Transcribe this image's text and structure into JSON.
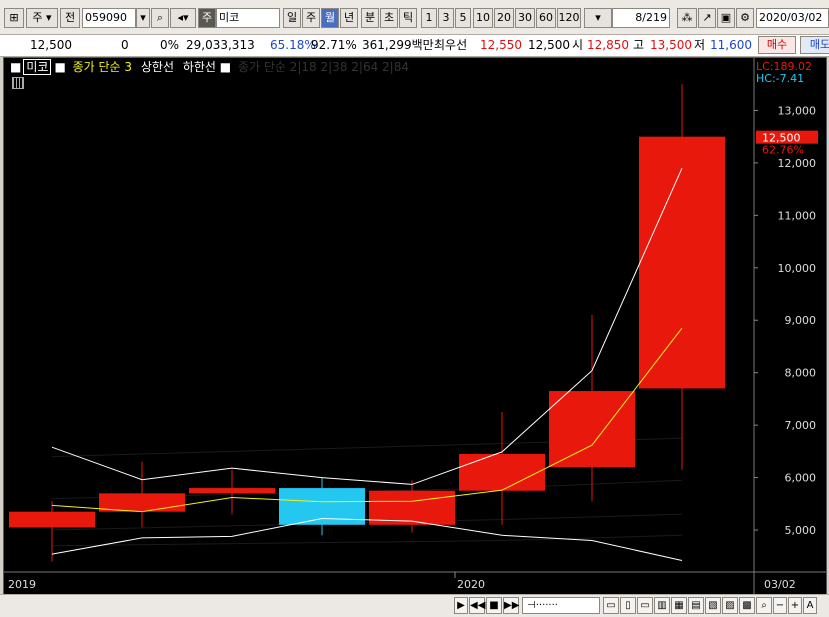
{
  "toolbar": {
    "period_label": "주",
    "prev_label": "전",
    "code": "059090",
    "market_tag": "주",
    "stock_name": "미코",
    "intervals": [
      "일",
      "주",
      "월",
      "년",
      "분",
      "초",
      "틱"
    ],
    "selected_interval": "월",
    "numbers": [
      "1",
      "3",
      "5",
      "10",
      "20",
      "30",
      "60",
      "120"
    ],
    "counter": "8/219",
    "date": "2020/03/02"
  },
  "quote": {
    "price": "12,500",
    "change": "0",
    "change_rate": "0%",
    "volume": "29,033,313",
    "pct1": "65.18%",
    "pct2": "92.71%",
    "amount": "361,299백만",
    "preferred_label": "최우선",
    "preferred_value": "12,550",
    "ask_value": "12,500",
    "open_label": "시",
    "open_value": "12,850",
    "high_label": "고",
    "high_value": "13,500",
    "low_label": "저",
    "low_value": "11,600",
    "buy_label": "매수",
    "sell_label": "매도"
  },
  "legend": {
    "tag": "미코",
    "ma_label": "종가 단순 3",
    "upper_label": "상한선",
    "lower_label": "하한선",
    "dim_label": "종가 단순 2|18 2|38 2|64 2|84"
  },
  "right_info": {
    "lc": "LC:189.02",
    "hc": "HC:-7.41",
    "current": "12,500",
    "rate": "62.76%"
  },
  "colors": {
    "up": "#e8180c",
    "down": "#23c7ef",
    "ma": "#f2f21c",
    "band": "#ffffff",
    "background": "#000000"
  },
  "chart_data": {
    "type": "candlestick",
    "x": [
      "2019-03",
      "2019-04",
      "2019-05",
      "2019-06",
      "2019-07",
      "2019-08",
      "2019-09",
      "2019-10",
      "2020-03"
    ],
    "open": [
      5050,
      5350,
      5700,
      5800,
      5100,
      5750,
      6200,
      7700,
      7850
    ],
    "high": [
      5550,
      6300,
      6150,
      6000,
      5950,
      7250,
      9100,
      13500,
      13500
    ],
    "low": [
      4400,
      5050,
      5300,
      4900,
      4950,
      5100,
      5550,
      6150,
      6200
    ],
    "close": [
      5350,
      5700,
      5800,
      5100,
      5750,
      6450,
      7650,
      12500,
      12500
    ],
    "series": [
      {
        "name": "종가 단순 3",
        "values": [
          5470,
          5350,
          5620,
          5540,
          5550,
          5760,
          6620,
          8850,
          8850
        ]
      },
      {
        "name": "상한선",
        "values": [
          6580,
          5960,
          6180,
          6000,
          5870,
          6490,
          8040,
          11900,
          11900
        ]
      },
      {
        "name": "하한선",
        "values": [
          4540,
          4850,
          4880,
          5220,
          5170,
          4900,
          4800,
          4420,
          4420
        ]
      }
    ],
    "ylim": [
      4200,
      14000
    ],
    "y_ticks": [
      5000,
      6000,
      7000,
      8000,
      9000,
      10000,
      11000,
      12000,
      13000
    ],
    "y_tick_labels": [
      "5,000",
      "6,000",
      "7,000",
      "8,000",
      "9,000",
      "10,000",
      "11,000",
      "12,000",
      "13,000"
    ],
    "x_labels": [
      "2019",
      "2020",
      "03/02"
    ],
    "legend_position": "top-left",
    "grid": false
  }
}
